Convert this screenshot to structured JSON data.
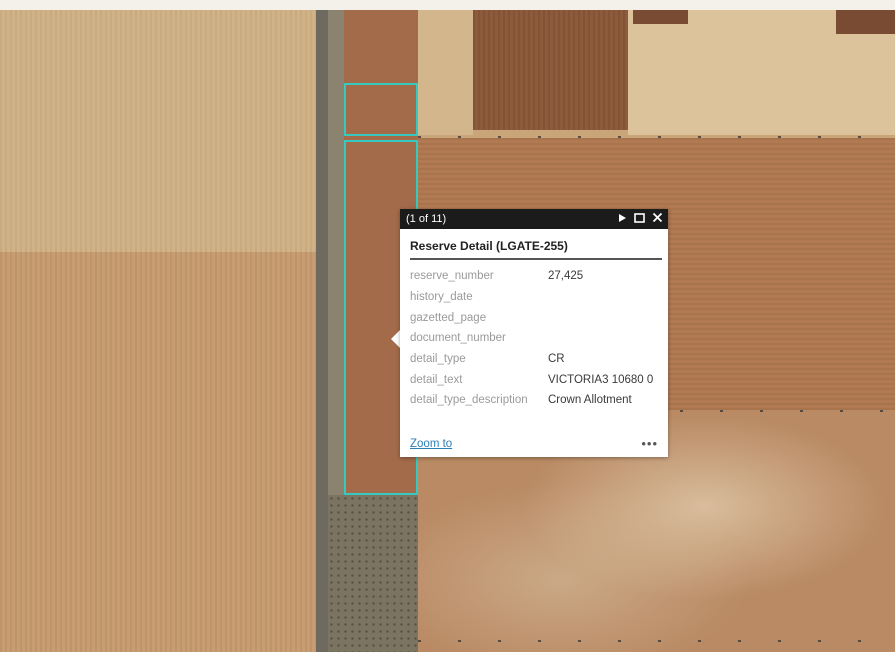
{
  "map": {
    "highlight_color": "#35c9c0",
    "terrain_colors": {
      "pale_field": "#d3b58b",
      "dark_field": "#8e5a3c",
      "mid_field": "#b98055",
      "road": "#6f6a60",
      "bush": "#5a5446"
    }
  },
  "popup": {
    "counter": "(1 of 11)",
    "icons": {
      "next": "next-feature-icon",
      "maximize": "maximize-icon",
      "close": "close-icon"
    },
    "title": "Reserve Detail (LGATE-255)",
    "fields": [
      {
        "key": "reserve_number",
        "value": "27,425"
      },
      {
        "key": "history_date",
        "value": ""
      },
      {
        "key": "gazetted_page",
        "value": ""
      },
      {
        "key": "document_number",
        "value": ""
      },
      {
        "key": "detail_type",
        "value": "CR"
      },
      {
        "key": "detail_text",
        "value": "VICTORIA3 10680 0"
      },
      {
        "key": "detail_type_description",
        "value": "Crown Allotment"
      }
    ],
    "zoom_label": "Zoom to",
    "more_label": "•••"
  }
}
